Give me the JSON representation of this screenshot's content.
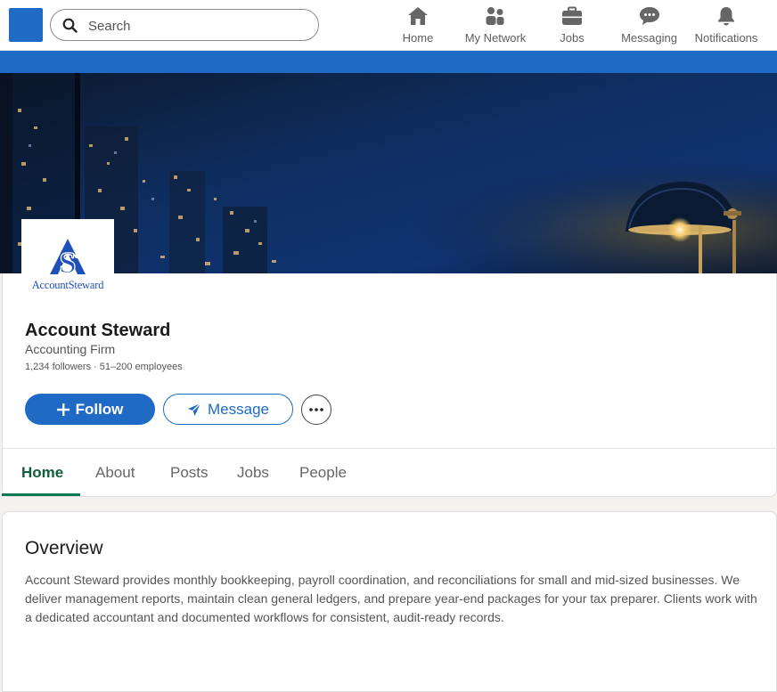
{
  "topnav": {
    "search_placeholder": "Search",
    "items": [
      {
        "label": "Home",
        "icon": "home-icon"
      },
      {
        "label": "My Network",
        "icon": "network-icon"
      },
      {
        "label": "Jobs",
        "icon": "briefcase-icon"
      },
      {
        "label": "Messaging",
        "icon": "messaging-icon"
      },
      {
        "label": "Notifications",
        "icon": "bell-icon"
      }
    ]
  },
  "colors": {
    "brand_blue": "#1f6ac4",
    "tab_active": "#0f5f3c",
    "background": "#f3f2ef"
  },
  "company": {
    "logo_text": "AccountSteward",
    "name": "Account Steward",
    "industry": "Accounting Firm",
    "meta": "1,234 followers · 51–200 employees"
  },
  "actions": {
    "follow_label": "Follow",
    "message_label": "Message"
  },
  "tabs": [
    {
      "label": "Home",
      "active": true
    },
    {
      "label": "About",
      "active": false
    },
    {
      "label": "Posts",
      "active": false
    },
    {
      "label": "Jobs",
      "active": false
    },
    {
      "label": "People",
      "active": false
    }
  ],
  "overview": {
    "title": "Overview",
    "text": "Account Steward provides monthly bookkeeping, payroll coordination, and reconciliations for small and mid-sized businesses. We deliver management reports, maintain clean general ledgers, and prepare year-end packages for your tax preparer. Clients work with a dedicated accountant and documented workflows for consistent, audit-ready records."
  }
}
